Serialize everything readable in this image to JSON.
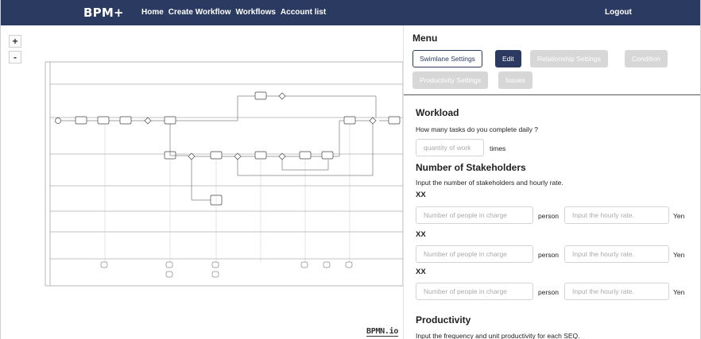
{
  "navbar": {
    "brand": "BPM+",
    "links": [
      "Home",
      "Create Workflow",
      "Workflows",
      "Account list"
    ],
    "logout": "Logout"
  },
  "canvas": {
    "zoom_in": "+",
    "zoom_out": "-",
    "logo": "BPMN.io"
  },
  "panel": {
    "menu_title": "Menu",
    "buttons": {
      "swimlane": "Swimlane Settings",
      "edit": "Edit",
      "relationship": "Relationship Settings",
      "condition": "Condition",
      "productivity": "Productivity Settings",
      "issues": "Issues"
    },
    "workload": {
      "title": "Workload",
      "question": "How many tasks do you complete daily ?",
      "placeholder": "quantity of work",
      "unit": "times"
    },
    "stakeholders": {
      "title": "Number of Stakeholders",
      "description": "Input the number of stakeholders and hourly rate.",
      "rows": [
        {
          "label": "XX",
          "people_placeholder": "Number of people in charge",
          "person_unit": "person",
          "rate_placeholder": "Input the hourly rate.",
          "rate_unit": "Yen"
        },
        {
          "label": "XX",
          "people_placeholder": "Number of people in charge",
          "person_unit": "person",
          "rate_placeholder": "Input the hourly rate.",
          "rate_unit": "Yen"
        },
        {
          "label": "XX",
          "people_placeholder": "Number of people in charge",
          "person_unit": "person",
          "rate_placeholder": "Input the hourly rate.",
          "rate_unit": "Yen"
        }
      ]
    },
    "productivity": {
      "title": "Productivity",
      "description": "Input the frequency and unit productivity for each SEQ."
    }
  }
}
